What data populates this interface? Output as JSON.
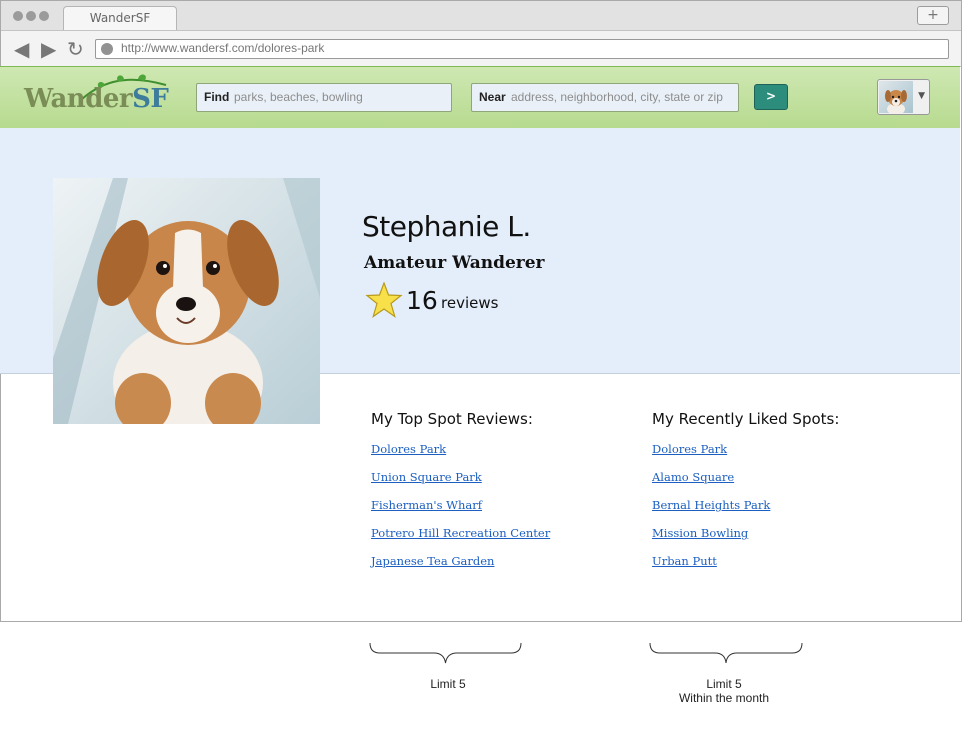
{
  "browser": {
    "tab_title": "WanderSF",
    "new_tab_glyph": "+",
    "url": "http://www.wandersf.com/dolores-park",
    "icons": [
      "back-icon",
      "forward-icon",
      "reload-icon"
    ]
  },
  "header": {
    "logo_main": "Wander",
    "logo_accent": "SF",
    "find_label": "Find",
    "find_placeholder": "parks, beaches, bowling",
    "near_label": "Near",
    "near_placeholder": "address, neighborhood, city, state or zip",
    "go_label": ">",
    "brand_colors": {
      "header_green": "#b6da8e",
      "button_teal": "#2d8d7c",
      "logo_blue": "#3d7c9a"
    }
  },
  "profile": {
    "name": "Stephanie L.",
    "rank": "Amateur Wanderer",
    "review_count": "16",
    "review_word": "reviews",
    "photo_alt": "puppy avatar"
  },
  "top_reviews": {
    "heading": "My Top Spot Reviews:",
    "items": [
      "Dolores Park",
      "Union Square Park",
      "Fisherman's Wharf",
      "Potrero Hill Recreation Center",
      "Japanese Tea Garden"
    ]
  },
  "recent_likes": {
    "heading": "My Recently Liked Spots:",
    "items": [
      "Dolores Park",
      "Alamo Square",
      "Bernal Heights Park",
      "Mission Bowling",
      "Urban Putt"
    ]
  },
  "annotations": {
    "left_note": "Limit 5",
    "right_note_line1": "Limit 5",
    "right_note_line2": "Within the month"
  }
}
